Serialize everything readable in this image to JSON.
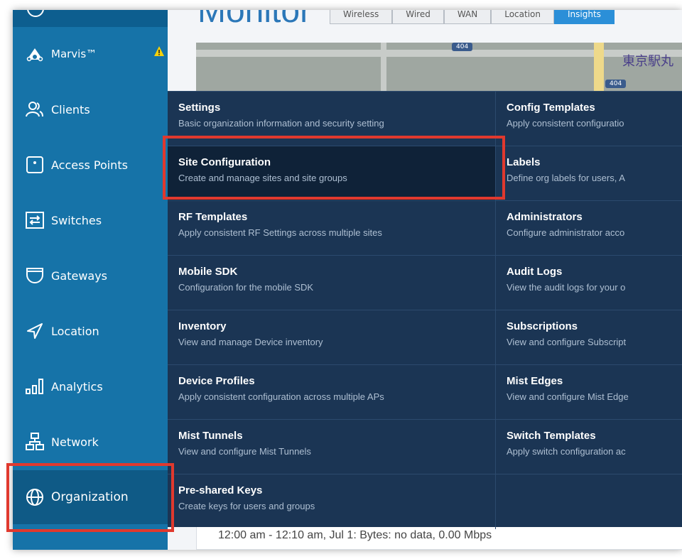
{
  "page": {
    "title": "Monitor"
  },
  "tabs": [
    {
      "label": "Wireless"
    },
    {
      "label": "Wired"
    },
    {
      "label": "WAN"
    },
    {
      "label": "Location"
    },
    {
      "label": "Insights"
    }
  ],
  "map": {
    "city_label": "東京駅丸",
    "shield_a": "404",
    "shield_b": "404"
  },
  "sidebar": {
    "items": [
      {
        "label": "Marvis™",
        "icon": "marvis-icon"
      },
      {
        "label": "Clients",
        "icon": "clients-icon"
      },
      {
        "label": "Access Points",
        "icon": "access-point-icon"
      },
      {
        "label": "Switches",
        "icon": "switch-icon"
      },
      {
        "label": "Gateways",
        "icon": "gateway-icon"
      },
      {
        "label": "Location",
        "icon": "location-icon"
      },
      {
        "label": "Analytics",
        "icon": "analytics-icon"
      },
      {
        "label": "Network",
        "icon": "network-icon"
      },
      {
        "label": "Organization",
        "icon": "globe-icon"
      }
    ]
  },
  "menu": {
    "left": [
      {
        "title": "Settings",
        "desc": "Basic organization information and security setting"
      },
      {
        "title": "Site Configuration",
        "desc": "Create and manage sites and site groups"
      },
      {
        "title": "RF Templates",
        "desc": "Apply consistent RF Settings across multiple sites"
      },
      {
        "title": "Mobile SDK",
        "desc": "Configuration for the mobile SDK"
      },
      {
        "title": "Inventory",
        "desc": "View and manage Device inventory"
      },
      {
        "title": "Device Profiles",
        "desc": "Apply consistent configuration across multiple APs"
      },
      {
        "title": "Mist Tunnels",
        "desc": "View and configure Mist Tunnels"
      },
      {
        "title": "Pre-shared Keys",
        "desc": "Create keys for users and groups"
      }
    ],
    "right": [
      {
        "title": "Config Templates",
        "desc": "Apply consistent configuratio"
      },
      {
        "title": "Labels",
        "desc": "Define org labels for users, A"
      },
      {
        "title": "Administrators",
        "desc": "Configure administrator acco"
      },
      {
        "title": "Audit Logs",
        "desc": "View the audit logs for your o"
      },
      {
        "title": "Subscriptions",
        "desc": "View and configure Subscript"
      },
      {
        "title": "Mist Edges",
        "desc": "View and configure Mist Edge"
      },
      {
        "title": "Switch Templates",
        "desc": "Apply switch configuration ac"
      }
    ]
  },
  "status": {
    "text": "12:00 am - 12:10 am, Jul 1: Bytes: no data, 0.00 Mbps"
  },
  "colors": {
    "sidebar": "#1673a8",
    "menu": "#1b3554",
    "callout": "#e0392e",
    "accent": "#2b8fd8"
  }
}
